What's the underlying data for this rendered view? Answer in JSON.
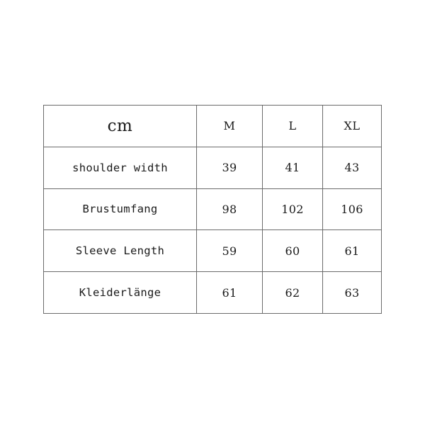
{
  "page": {
    "background_color": "#ffffff",
    "border_color": "#6b6b6b",
    "text_color": "#1a1a1a"
  },
  "chart_data": {
    "type": "table",
    "title": "",
    "unit_header": "cm",
    "categories": [
      "M",
      "L",
      "XL"
    ],
    "row_labels": [
      "shoulder width",
      "Brustumfang",
      "Sleeve Length",
      "Kleiderlänge"
    ],
    "series": [
      {
        "name": "shoulder width",
        "values": [
          39,
          41,
          43
        ]
      },
      {
        "name": "Brustumfang",
        "values": [
          98,
          102,
          106
        ]
      },
      {
        "name": "Sleeve Length",
        "values": [
          59,
          60,
          61
        ]
      },
      {
        "name": "Kleiderlänge",
        "values": [
          61,
          62,
          63
        ]
      }
    ],
    "grid": true,
    "legend": "none"
  },
  "table": {
    "header": {
      "unit": "cm",
      "sizes": [
        "M",
        "L",
        "XL"
      ]
    },
    "rows": [
      {
        "label": "shoulder width",
        "m": "39",
        "l": "41",
        "xl": "43"
      },
      {
        "label": "Brustumfang",
        "m": "98",
        "l": "102",
        "xl": "106"
      },
      {
        "label": "Sleeve Length",
        "m": "59",
        "l": "60",
        "xl": "61"
      },
      {
        "label": "Kleiderlänge",
        "m": "61",
        "l": "62",
        "xl": "63"
      }
    ]
  }
}
